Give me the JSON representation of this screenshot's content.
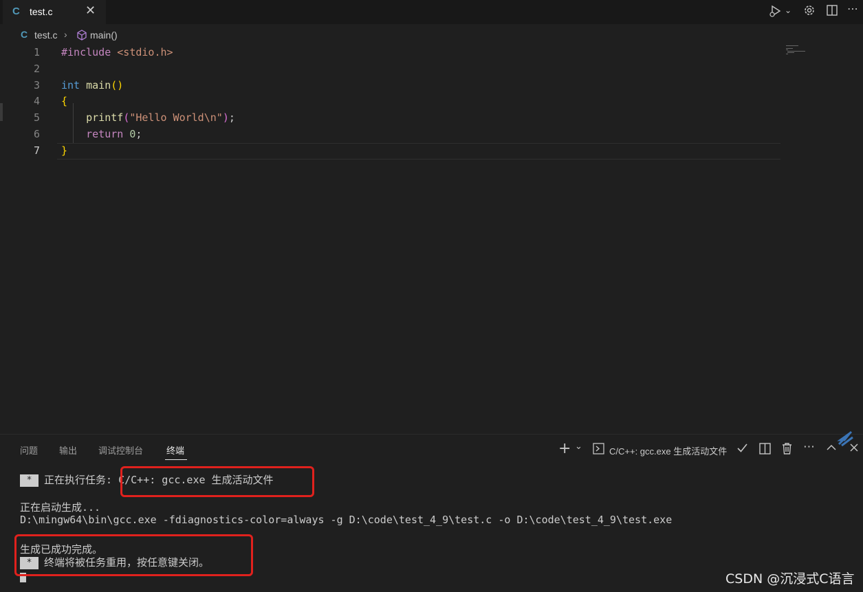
{
  "tab": {
    "icon": "C",
    "label": "test.c",
    "close": "✕"
  },
  "toolbar": {
    "icons": [
      "run-debug-icon",
      "settings-icon",
      "split-editor-icon",
      "more-icon"
    ]
  },
  "breadcrumb": {
    "icon": "C",
    "file": "test.c",
    "separator": "›",
    "symbol": "main()"
  },
  "editor": {
    "line_numbers": [
      "1",
      "2",
      "3",
      "4",
      "5",
      "6",
      "7"
    ],
    "active_line": "7",
    "code": {
      "l1_directive": "#include ",
      "l1_header": "<stdio.h>",
      "l3_type": "int ",
      "l3_func": "main",
      "l3_parens": "()",
      "l4_open": "{",
      "l5_indent": "    ",
      "l5_func": "printf",
      "l5_lparen": "(",
      "l5_string": "\"Hello World\\n\"",
      "l5_rparen": ")",
      "l5_semi": ";",
      "l6_indent": "    ",
      "l6_kw": "return ",
      "l6_num": "0",
      "l6_semi": ";",
      "l7_close": "}"
    }
  },
  "panel": {
    "tabs": [
      "问题",
      "输出",
      "调试控制台",
      "终端"
    ],
    "active_tab": "终端",
    "terminal_name": "C/C++: gcc.exe 生成活动文件",
    "icons": [
      "plus-icon",
      "chevron-down-icon",
      "terminal-icon",
      "check-icon",
      "split-terminal-icon",
      "trash-icon",
      "more-icon",
      "chevron-up-icon",
      "close-icon"
    ]
  },
  "terminal": {
    "star": "*",
    "line1_prefix": "正在执行任务",
    "line1_task": ": C/C++: gcc.exe 生成活动文件",
    "line2": "正在启动生成...",
    "line3": "D:\\mingw64\\bin\\gcc.exe -fdiagnostics-color=always -g D:\\code\\test_4_9\\test.c -o D:\\code\\test_4_9\\test.exe",
    "line4": "生成已成功完成。",
    "line5": "终端将被任务重用，按任意键关闭。"
  },
  "watermark": "CSDN @沉浸式C语言",
  "colors": {
    "accent_red": "#e0211d",
    "background": "#1f1f1f",
    "c_icon": "#519aba"
  }
}
